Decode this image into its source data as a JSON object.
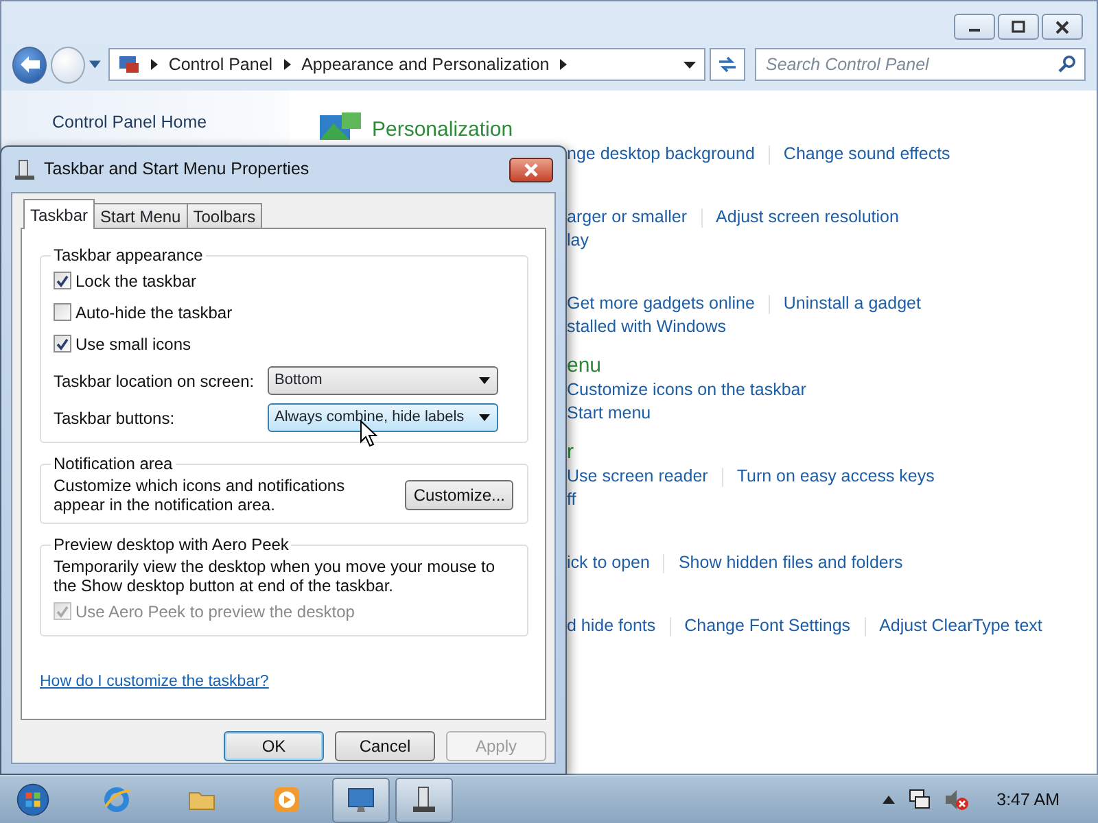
{
  "explorer": {
    "address": [
      "Control Panel",
      "Appearance and Personalization"
    ],
    "search": {
      "placeholder": "Search Control Panel"
    },
    "sidebar": [
      "Control Panel Home"
    ],
    "sections": [
      {
        "kind": "full",
        "title": "Personalization",
        "links": [
          "nge desktop background",
          "Change sound effects"
        ]
      },
      {
        "kind": "clipped",
        "links": [
          "arger or smaller",
          "Adjust screen resolution"
        ],
        "sublinks": [
          "lay"
        ]
      },
      {
        "kind": "clipped",
        "links": [
          "Get more gadgets online",
          "Uninstall a gadget"
        ],
        "sublinks": [
          "stalled with Windows"
        ]
      },
      {
        "kind": "clipped",
        "title": "enu",
        "links": [
          "Customize icons on the taskbar"
        ],
        "sublinks": [
          "Start menu"
        ]
      },
      {
        "kind": "clipped",
        "title": "r",
        "links": [
          "Use screen reader",
          "Turn on easy access keys"
        ],
        "sublinks": [
          "ff"
        ]
      },
      {
        "kind": "clipped",
        "links": [
          "ick to open",
          "Show hidden files and folders"
        ]
      },
      {
        "kind": "clipped",
        "links": [
          "d hide fonts",
          "Change Font Settings",
          "Adjust ClearType text"
        ]
      }
    ]
  },
  "dialog": {
    "title": "Taskbar and Start Menu Properties",
    "tabs": [
      {
        "label": "Taskbar",
        "selected": true
      },
      {
        "label": "Start Menu",
        "selected": false
      },
      {
        "label": "Toolbars",
        "selected": false
      }
    ],
    "groups": [
      {
        "title": "Taskbar appearance",
        "items": [
          {
            "kind": "checkbox",
            "label": "Lock the taskbar",
            "checked": true,
            "disabled": false
          },
          {
            "kind": "checkbox",
            "label": "Auto-hide the taskbar",
            "checked": false,
            "disabled": false
          },
          {
            "kind": "checkbox",
            "label": "Use small icons",
            "checked": true,
            "disabled": false
          },
          {
            "kind": "select",
            "label": "Taskbar location on screen:",
            "value": "Bottom",
            "focused": false
          },
          {
            "kind": "select",
            "label": "Taskbar buttons:",
            "value": "Always combine, hide labels",
            "focused": true
          }
        ]
      },
      {
        "title": "Notification area",
        "items": [
          {
            "kind": "text-button",
            "text": "Customize which icons and notifications appear in the notification area.",
            "button": "Customize..."
          }
        ]
      },
      {
        "title": "Preview desktop with Aero Peek",
        "items": [
          {
            "kind": "text",
            "text": "Temporarily view the desktop when you move your mouse to the Show desktop button at end of the taskbar."
          },
          {
            "kind": "checkbox",
            "label": "Use Aero Peek to preview the desktop",
            "checked": true,
            "disabled": true
          }
        ]
      }
    ],
    "help_link": "How do I customize the taskbar?",
    "buttons": [
      {
        "label": "OK",
        "default": true,
        "disabled": false
      },
      {
        "label": "Cancel",
        "default": false,
        "disabled": false
      },
      {
        "label": "Apply",
        "default": false,
        "disabled": true
      }
    ]
  },
  "taskbar": {
    "apps": [
      {
        "kind": "browser",
        "active": false
      },
      {
        "kind": "folder",
        "active": false
      },
      {
        "kind": "media",
        "active": false
      },
      {
        "kind": "control-panel",
        "active": true
      },
      {
        "kind": "properties",
        "active": true
      }
    ],
    "clock": "3:47 AM"
  }
}
